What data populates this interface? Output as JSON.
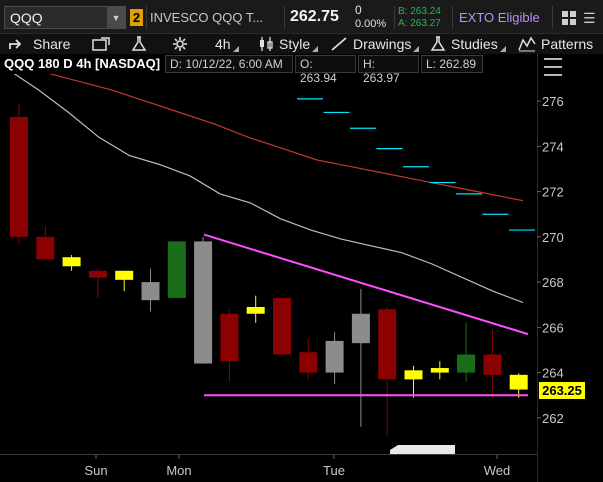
{
  "quote": {
    "symbol": "QQQ",
    "link_number": "2",
    "description": "INVESCO QQQ T...",
    "last": "262.75",
    "change": "0",
    "change_pct": "0.00%",
    "bid": "B: 263.24",
    "ask": "A: 263.27",
    "exto": "EXTO Eligible"
  },
  "toolbar": {
    "share": "Share",
    "timeframe": "4h",
    "style": "Style",
    "drawings": "Drawings",
    "studies": "Studies",
    "patterns": "Patterns"
  },
  "chart_header": {
    "title": "QQQ 180 D 4h [NASDAQ]",
    "date": "D: 10/12/22, 6:00 AM",
    "open": "O: 263.94",
    "high": "H: 263.97",
    "low": "L: 262.89"
  },
  "current_price_label": "263.25",
  "colors": {
    "up_candle": "#1a6e1a",
    "down_candle": "#8b0000",
    "neutral_candle": "#8c8c8c",
    "doji_candle": "#ffff00",
    "trendline": "#ff4dff",
    "ma_red": "#c0392b",
    "ma_gray": "#bdbdbd",
    "level_cyan": "#00e5ff"
  },
  "chart_data": {
    "type": "candlestick",
    "y_ticks": [
      "276",
      "274",
      "272",
      "270",
      "268",
      "266",
      "264",
      "262"
    ],
    "ylim": [
      260.4,
      277.2
    ],
    "x_ticks": [
      "Sun",
      "Mon",
      "Tue",
      "Wed"
    ],
    "candles": [
      {
        "o": 275.3,
        "h": 275.9,
        "l": 269.7,
        "c": 270.0,
        "kind": "down"
      },
      {
        "o": 270.0,
        "h": 270.5,
        "l": 269.0,
        "c": 269.0,
        "kind": "down"
      },
      {
        "o": 269.1,
        "h": 269.2,
        "l": 268.5,
        "c": 268.7,
        "kind": "doji"
      },
      {
        "o": 268.5,
        "h": 268.6,
        "l": 267.3,
        "c": 268.2,
        "kind": "down"
      },
      {
        "o": 268.1,
        "h": 268.5,
        "l": 267.6,
        "c": 268.5,
        "kind": "doji"
      },
      {
        "o": 268.0,
        "h": 268.6,
        "l": 266.7,
        "c": 267.2,
        "kind": "neutral"
      },
      {
        "o": 267.3,
        "h": 269.8,
        "l": 267.3,
        "c": 269.8,
        "kind": "up"
      },
      {
        "o": 269.8,
        "h": 270.0,
        "l": 264.4,
        "c": 264.4,
        "kind": "neutral"
      },
      {
        "o": 266.6,
        "h": 266.8,
        "l": 263.6,
        "c": 264.5,
        "kind": "down"
      },
      {
        "o": 266.6,
        "h": 267.4,
        "l": 266.2,
        "c": 266.9,
        "kind": "doji"
      },
      {
        "o": 267.3,
        "h": 267.3,
        "l": 264.8,
        "c": 264.8,
        "kind": "down"
      },
      {
        "o": 264.9,
        "h": 265.5,
        "l": 263.7,
        "c": 264.0,
        "kind": "down"
      },
      {
        "o": 264.0,
        "h": 265.8,
        "l": 263.5,
        "c": 265.4,
        "kind": "neutral"
      },
      {
        "o": 265.3,
        "h": 267.7,
        "l": 261.6,
        "c": 266.6,
        "kind": "neutral"
      },
      {
        "o": 266.8,
        "h": 266.9,
        "l": 261.2,
        "c": 263.7,
        "kind": "down"
      },
      {
        "o": 263.7,
        "h": 264.3,
        "l": 262.9,
        "c": 264.1,
        "kind": "doji"
      },
      {
        "o": 264.0,
        "h": 264.5,
        "l": 263.7,
        "c": 264.2,
        "kind": "doji"
      },
      {
        "o": 264.0,
        "h": 266.2,
        "l": 263.6,
        "c": 264.8,
        "kind": "up"
      },
      {
        "o": 264.8,
        "h": 265.9,
        "l": 262.9,
        "c": 263.9,
        "kind": "down"
      },
      {
        "o": 263.9,
        "h": 263.97,
        "l": 262.89,
        "c": 263.25,
        "kind": "doji"
      }
    ],
    "ma_red": [
      277.6,
      277.3,
      276.9,
      276.5,
      276.0,
      275.5,
      275.0,
      274.4,
      273.9,
      273.4,
      273.1,
      272.8,
      272.5,
      272.2,
      271.9,
      271.6
    ],
    "ma_gray": [
      277.4,
      276.5,
      275.5,
      274.4,
      273.6,
      273.2,
      272.7,
      271.9,
      271.5,
      270.8,
      270.3,
      269.9,
      269.6,
      269.3,
      268.8,
      268.2,
      267.6,
      267.1
    ],
    "resistance_levels": [
      276.1,
      275.5,
      274.8,
      273.9,
      273.1,
      272.4,
      271.9,
      271.0,
      270.3
    ],
    "trendlines": [
      {
        "x0": 270.1,
        "x1": 265.7
      },
      {
        "x0": 263.0,
        "x1": 263.0
      }
    ]
  }
}
